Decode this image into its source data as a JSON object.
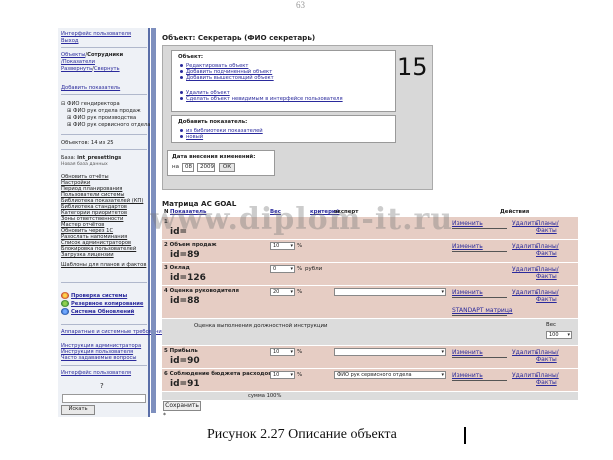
{
  "page_number": "63",
  "sidebar": {
    "top_link": "Интерфейс пользователя",
    "exit": "Выход",
    "nav_objects": "Объекты",
    "nav_slash1": "/",
    "nav_employees": "Сотрудники",
    "nav_indicators": "/Показатели",
    "expand": "Развернуть",
    "nav_slash2": "/",
    "collapse": "Свернуть",
    "add_indicator": "Добавить показатель",
    "tree": [
      "ФИО гендиректора",
      "ФИО рук отдела продаж",
      "ФИО рук производства",
      "ФИО рук сервисного отдела"
    ],
    "object_count": "Объектов: 14 из 25",
    "db_label": "База:",
    "db_name": "int_presettings",
    "db_sub": "Новая база данных",
    "menu": [
      "Обновить отчёты",
      "Настройки",
      "Период планирования",
      "Пользователи системы",
      "Библиотека показателей (КП)",
      "Библиотека стандартов",
      "Категории приоритетов",
      "Зоны ответственности",
      "Мастер отчётов",
      "Обновить через 1С",
      "Разослать напоминания",
      "Список администраторов",
      "Блокировка пользователей",
      "Загрузка лицензии"
    ],
    "templates": "Шаблоны для планов и фактов",
    "system_items": [
      "Проверка системы",
      "Резервное копирование",
      "Система Обновлений"
    ],
    "help_items": [
      "Аппаратные и системные требования",
      "Инструкция администратора",
      "Инструкция пользователя",
      "Часто задаваемые вопросы"
    ],
    "ui_link": "Интерфейс пользователя",
    "question": "?",
    "search_value": "",
    "search_button": "Искать"
  },
  "object": {
    "title": "Объект: Секретарь (ФИО секретарь)",
    "number": "15",
    "box1_title": "Объект:",
    "box1_items": [
      "Редактировать объект",
      "Добавить подчиненный объект",
      "Добавить вышестоящий объект"
    ],
    "box1_items2": [
      "Удалить объект",
      "Сделать объект невидимым в интерфейсе пользователя"
    ],
    "box2_title": "Добавить показатель:",
    "box2_items": [
      "из библиотеки показателей",
      "новый"
    ],
    "box3_title": "Дата внесения изменений:",
    "date_prefix": "на",
    "date_day": "08",
    "date_year": "2009",
    "ok": "ОК"
  },
  "matrix": {
    "title": "Матрица АС GOAL",
    "headers": {
      "n": "N",
      "indicator": "Показатель",
      "weight": "Вес",
      "critical": "критерий",
      "expert": "эксперт",
      "actions": "Действия"
    },
    "rows": [
      {
        "label": "1",
        "id": "id=",
        "edit": "Изменить",
        "delete": "Удалить",
        "plans": "Планы/Факты"
      },
      {
        "label": "2 Объем продаж",
        "id": "id=89",
        "weight": "10",
        "edit": "Изменить",
        "delete": "Удалить",
        "plans": "Планы/Факты"
      },
      {
        "label": "3 Оклад",
        "id": "id=126",
        "weight": "0",
        "unit": "рубли",
        "edit": "Изменить",
        "delete": "Удалить",
        "plans": "Планы/Факты"
      },
      {
        "label": "4 Оценка руководителя",
        "id": "id=88",
        "weight": "20",
        "edit": "Изменить",
        "delete": "Удалить",
        "plans": "Планы/Факты",
        "standart": "STANDAPT матрица"
      },
      {
        "label": "5 Прибыль",
        "id": "id=90",
        "weight": "10",
        "edit": "Изменить",
        "delete": "Удалить",
        "plans": "Планы/Факты"
      },
      {
        "label": "6 Соблюдение бюджета расходов",
        "id": "id=91",
        "weight": "10",
        "expert": "ФИО рук сервисного отдела",
        "edit": "Изменить",
        "delete": "Удалить",
        "plans": "Планы/Факты"
      }
    ],
    "percent": "%",
    "job_instruction": "Оценка выполнения должностной инструкции",
    "weight_label": "Вес",
    "weight_value": "100",
    "sum": "сумма 100%",
    "save": "Сохранить",
    "footnote": "*"
  },
  "watermark": "www.diplom-it.ru",
  "caption": "Рисунок 2.27 Описание объекта"
}
